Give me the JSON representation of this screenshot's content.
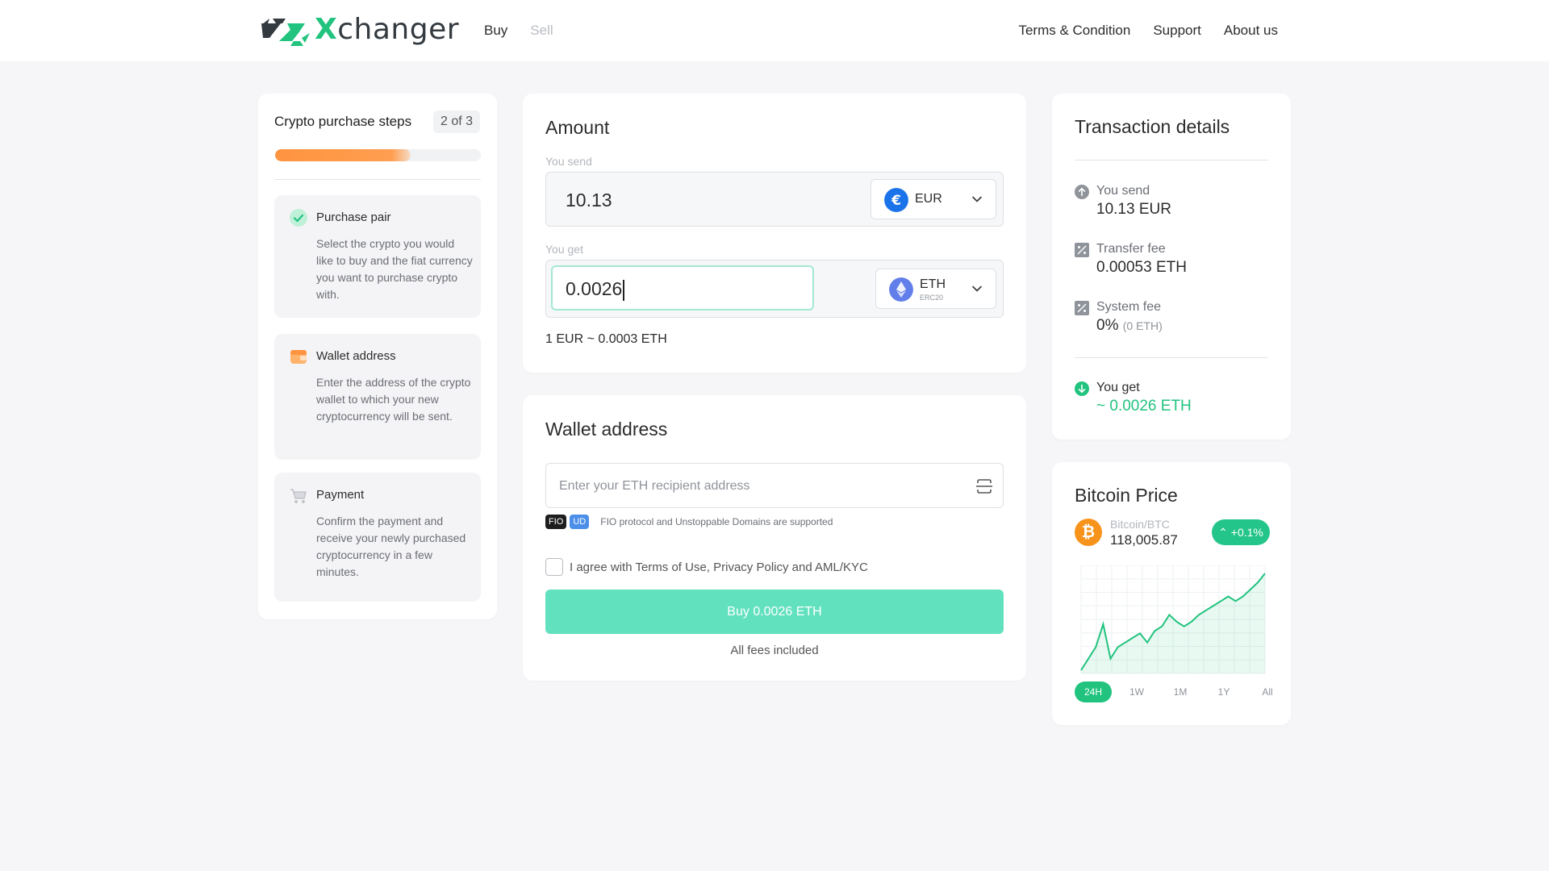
{
  "brand": {
    "name_prefix": "X",
    "name_rest": "changer"
  },
  "nav": {
    "buy": "Buy",
    "sell": "Sell",
    "terms": "Terms & Condition",
    "support": "Support",
    "about": "About us"
  },
  "steps": {
    "title": "Crypto purchase steps",
    "count": "2 of 3",
    "progress": 0.66,
    "items": [
      {
        "title": "Purchase pair",
        "desc": "Select the crypto you would like to buy and the fiat currency you want to purchase crypto with.",
        "icon": "check-circle-icon"
      },
      {
        "title": "Wallet address",
        "desc": "Enter the address of the crypto wallet to which your new cryptocurrency will be sent.",
        "icon": "wallet-icon"
      },
      {
        "title": "Payment",
        "desc": "Confirm the payment and receive your newly purchased cryptocurrency in a few minutes.",
        "icon": "cart-icon"
      }
    ]
  },
  "amount": {
    "title": "Amount",
    "send_label": "You send",
    "send_value": "10.13",
    "send_currency": "EUR",
    "get_label": "You get",
    "get_value": "0.0026",
    "get_currency": "ETH",
    "get_network": "ERC20",
    "rate": "1 EUR ~ 0.0003 ETH"
  },
  "wallet": {
    "title": "Wallet address",
    "placeholder": "Enter your ETH recipient address",
    "badge_fio": "FIO",
    "badge_ud": "UD",
    "support_text": "FIO protocol and Unstoppable Domains are supported",
    "agree_text": "I agree with Terms of Use, Privacy Policy and AML/KYC",
    "buy_label": "Buy 0.0026 ETH",
    "fees_text": "All fees included"
  },
  "transaction": {
    "title": "Transaction details",
    "send_label": "You send",
    "send_value": "10.13 EUR",
    "transfer_label": "Transfer fee",
    "transfer_value": "0.00053 ETH",
    "system_label": "System fee",
    "system_value": "0%",
    "system_sub": "(0 ETH)",
    "get_label": "You get",
    "get_value": "~ 0.0026 ETH"
  },
  "bitcoin": {
    "title": "Bitcoin Price",
    "pair": "Bitcoin/BTC",
    "price": "118,005.87",
    "change": "+0.1%",
    "ranges": [
      "24H",
      "1W",
      "1M",
      "1Y",
      "All"
    ],
    "active_range": "24H"
  },
  "chart_data": {
    "type": "area",
    "x": [
      0,
      1,
      2,
      3,
      4,
      5,
      6,
      7,
      8,
      9,
      10,
      11,
      12,
      13,
      14,
      15,
      16,
      17,
      18,
      19,
      20,
      21,
      22,
      23,
      24,
      25
    ],
    "values": [
      117980,
      117985,
      117990,
      118000,
      117985,
      117990,
      117992,
      117994,
      117996,
      117992,
      117997,
      117999,
      118004,
      118001,
      117999,
      118001,
      118004,
      118006,
      118008,
      118010,
      118012,
      118010,
      118012,
      118015,
      118018,
      118022
    ],
    "color": "#21c37e"
  },
  "colors": {
    "accent": "#21c37e",
    "button": "#62e1bf",
    "progress": "#ff9440",
    "eur": "#1a73e8",
    "eth": "#627eea",
    "btc": "#f7931a"
  }
}
